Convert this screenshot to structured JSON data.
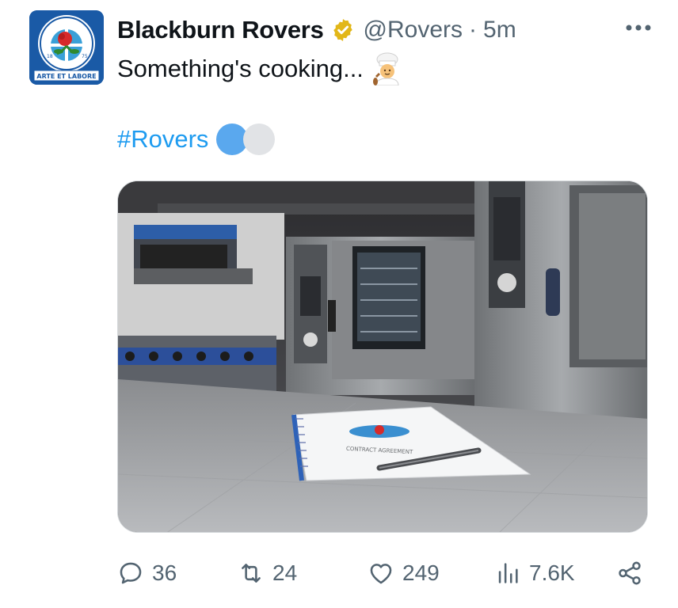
{
  "tweet": {
    "author_name": "Blackburn Rovers",
    "handle": "@Rovers",
    "separator": "·",
    "time": "5m",
    "text": "Something's cooking...",
    "hashtag": "#Rovers",
    "avatar": {
      "top_text": "BLACKBURN ROVERS F.C.",
      "motto": "ARTE ET LABORE",
      "year_left": "18",
      "year_right": "75"
    },
    "media": {
      "document_title": "CONTRACT AGREEMENT"
    },
    "stats": {
      "replies": "36",
      "retweets": "24",
      "likes": "249",
      "views": "7.6K"
    }
  },
  "icons": {
    "verified": "verified-gold-badge-icon",
    "more": "more-dots-icon",
    "chef": "chef-emoji-icon",
    "reply": "reply-icon",
    "retweet": "retweet-icon",
    "like": "heart-icon",
    "views": "views-chart-icon",
    "share": "share-icon"
  },
  "colors": {
    "link": "#1d9bf0",
    "secondary_text": "#536471",
    "verified_gold": "#e2b719",
    "hashtag_dot_blue": "#5aa8ee",
    "hashtag_dot_grey": "#e1e3e6"
  }
}
